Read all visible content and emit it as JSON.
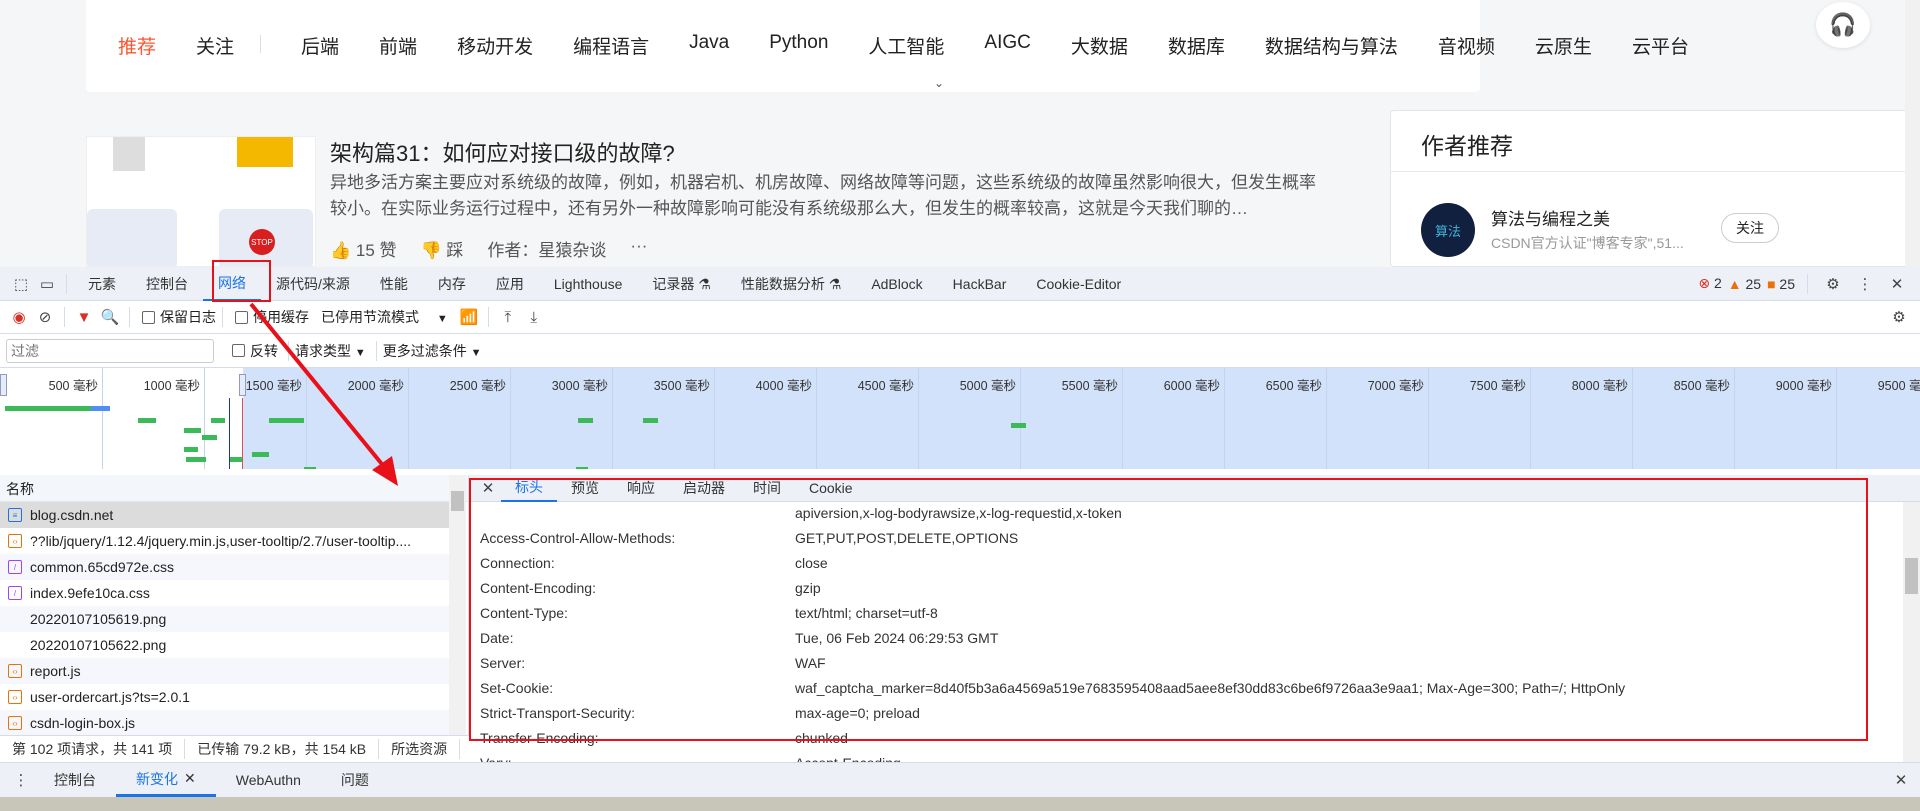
{
  "nav": {
    "items": [
      "推荐",
      "关注",
      "后端",
      "前端",
      "移动开发",
      "编程语言",
      "Java",
      "Python",
      "人工智能",
      "AIGC",
      "大数据",
      "数据库",
      "数据结构与算法",
      "音视频",
      "云原生",
      "云平台"
    ],
    "active": "推荐"
  },
  "article": {
    "title": "架构篇31：如何应对接口级的故障?",
    "desc": "异地多活方案主要应对系统级的故障，例如，机器宕机、机房故障、网络故障等问题，这些系统级的故障虽然影响很大，但发生概率较小。在实际业务运行过程中，还有另外一种故障影响可能没有系统级那么大，但发生的概率较高，这就是今天我们聊的…",
    "likes": "15 赞",
    "dislike": "踩",
    "author": "作者：星猿杂谈",
    "more": "···",
    "thumb_stop": "STOP"
  },
  "author_panel": {
    "title": "作者推荐",
    "name": "算法与编程之美",
    "desc": "CSDN官方认证\"博客专家\",51...",
    "follow": "关注",
    "avatar_text": "算法"
  },
  "devtools": {
    "tabs": [
      "元素",
      "控制台",
      "网络",
      "源代码/来源",
      "性能",
      "内存",
      "应用",
      "Lighthouse",
      "记录器 ⚗",
      "性能数据分析 ⚗",
      "AdBlock",
      "HackBar",
      "Cookie-Editor"
    ],
    "active_tab": "网络",
    "errors": "2",
    "warnings": "25",
    "issues": "25",
    "toolbar": {
      "preserve_log": "保留日志",
      "disable_cache": "停用缓存",
      "throttle": "已停用节流模式"
    },
    "filter": {
      "placeholder": "过滤",
      "invert": "反转",
      "request_types": "请求类型",
      "more_filters": "更多过滤条件"
    },
    "timeline_ticks": [
      "500 毫秒",
      "1000 毫秒",
      "1500 毫秒",
      "2000 毫秒",
      "2500 毫秒",
      "3000 毫秒",
      "3500 毫秒",
      "4000 毫秒",
      "4500 毫秒",
      "5000 毫秒",
      "5500 毫秒",
      "6000 毫秒",
      "6500 毫秒",
      "7000 毫秒",
      "7500 毫秒",
      "8000 毫秒",
      "8500 毫秒",
      "9000 毫秒",
      "9500 毫秒"
    ],
    "list": {
      "header": "名称",
      "rows": [
        {
          "name": "blog.csdn.net",
          "type": "doc"
        },
        {
          "name": "??lib/jquery/1.12.4/jquery.min.js,user-tooltip/2.7/user-tooltip....",
          "type": "js"
        },
        {
          "name": "common.65cd972e.css",
          "type": "css"
        },
        {
          "name": "index.9efe10ca.css",
          "type": "css"
        },
        {
          "name": "20220107105619.png",
          "type": "img"
        },
        {
          "name": "20220107105622.png",
          "type": "img"
        },
        {
          "name": "report.js",
          "type": "js"
        },
        {
          "name": "user-ordercart.js?ts=2.0.1",
          "type": "js"
        },
        {
          "name": "csdn-login-box.js",
          "type": "js"
        }
      ]
    },
    "status": {
      "requests": "第 102 项请求，共 141 项",
      "transferred": "已传输 79.2 kB，共 154 kB",
      "resources": "所选资源"
    },
    "detail_tabs": [
      "标头",
      "预览",
      "响应",
      "启动器",
      "时间",
      "Cookie"
    ],
    "active_detail_tab": "标头",
    "headers": [
      {
        "name": "",
        "value": "apiversion,x-log-bodyrawsize,x-log-requestid,x-token"
      },
      {
        "name": "Access-Control-Allow-Methods:",
        "value": "GET,PUT,POST,DELETE,OPTIONS"
      },
      {
        "name": "Connection:",
        "value": "close"
      },
      {
        "name": "Content-Encoding:",
        "value": "gzip"
      },
      {
        "name": "Content-Type:",
        "value": "text/html; charset=utf-8"
      },
      {
        "name": "Date:",
        "value": "Tue, 06 Feb 2024 06:29:53 GMT"
      },
      {
        "name": "Server:",
        "value": "WAF"
      },
      {
        "name": "Set-Cookie:",
        "value": "waf_captcha_marker=8d40f5b3a6a4569a519e7683595408aad5aee8ef30dd83c6be6f9726aa3e9aa1; Max-Age=300; Path=/; HttpOnly"
      },
      {
        "name": "Strict-Transport-Security:",
        "value": "max-age=0; preload"
      },
      {
        "name": "Transfer-Encoding:",
        "value": "chunked"
      },
      {
        "name": "Vary:",
        "value": "Accept-Encoding"
      }
    ],
    "drawer_tabs": [
      "控制台",
      "新变化",
      "WebAuthn",
      "问题"
    ],
    "active_drawer_tab": "新变化"
  },
  "colors": {
    "accent": "#1a73e8",
    "brand": "#fc5531",
    "annotation": "#e8111a"
  }
}
